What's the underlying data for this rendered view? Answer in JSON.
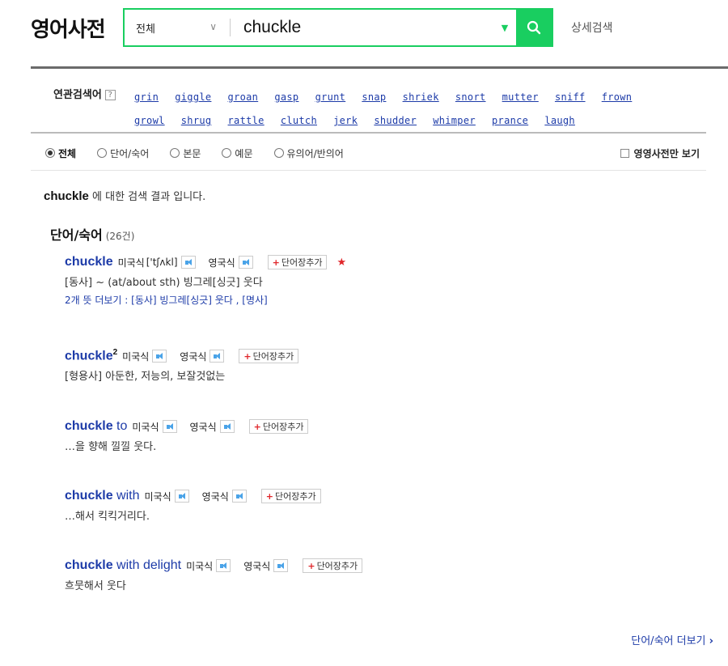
{
  "header": {
    "logo": "영어사전",
    "scope_label": "전체",
    "query": "chuckle",
    "advanced_label": "상세검색"
  },
  "related": {
    "label": "연관검색어",
    "help": "?",
    "words": [
      "grin",
      "giggle",
      "groan",
      "gasp",
      "grunt",
      "snap",
      "shriek",
      "snort",
      "mutter",
      "sniff",
      "frown",
      "growl",
      "shrug",
      "rattle",
      "clutch",
      "jerk",
      "shudder",
      "whimper",
      "prance",
      "laugh"
    ]
  },
  "filters": {
    "items": [
      {
        "label": "전체",
        "selected": true
      },
      {
        "label": "단어/숙어",
        "selected": false
      },
      {
        "label": "본문",
        "selected": false
      },
      {
        "label": "예문",
        "selected": false
      },
      {
        "label": "유의어/반의어",
        "selected": false
      }
    ],
    "eng_only_label": "영영사전만 보기"
  },
  "result": {
    "query": "chuckle",
    "text": "에 대한 검색 결과 입니다."
  },
  "section": {
    "title": "단어/숙어",
    "count": "(26건)"
  },
  "labels": {
    "us": "미국식",
    "uk": "영국식",
    "add": "단어장추가",
    "add_plus": "+"
  },
  "entries": [
    {
      "word": "chuckle",
      "suffix": "",
      "sup": "",
      "pron": "['tʃʌkl]",
      "meaning": "[동사] ~ (at/about sth) 빙그레[싱긋] 웃다",
      "more": "2개 뜻 더보기 : [동사] 빙그레[싱긋] 웃다 , [명사]",
      "star": "★"
    },
    {
      "word": "chuckle",
      "suffix": "",
      "sup": "2",
      "pron": "",
      "meaning": "[형용사] 아둔한, 저능의, 보잘것없는",
      "more": "",
      "star": ""
    },
    {
      "word": "chuckle",
      "suffix": " to",
      "sup": "",
      "pron": "",
      "meaning": "…을 향해 낄낄 웃다.",
      "more": "",
      "star": ""
    },
    {
      "word": "chuckle",
      "suffix": " with",
      "sup": "",
      "pron": "",
      "meaning": "…해서 킥킥거리다.",
      "more": "",
      "star": ""
    },
    {
      "word": "chuckle",
      "suffix": " with delight",
      "sup": "",
      "pron": "",
      "meaning": "흐뭇해서 웃다",
      "more": "",
      "star": ""
    }
  ],
  "more_link": {
    "label": "단어/숙어 더보기",
    "arrow": "›"
  }
}
